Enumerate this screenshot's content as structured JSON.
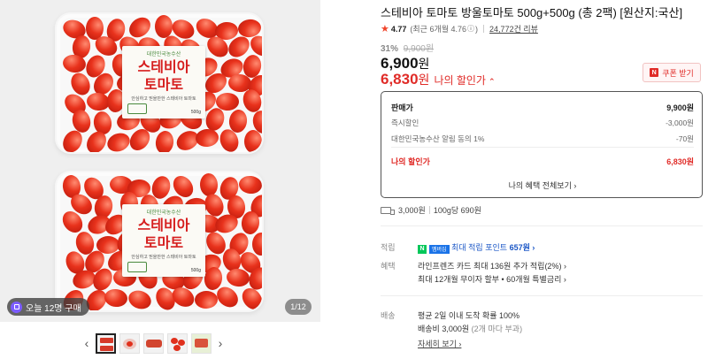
{
  "product": {
    "title": "스테비아 토마토 방울토마토 500g+500g (총 2팩) [원산지:국산]",
    "rating": "4.77",
    "recent_rating": "(최근 6개월 4.76",
    "recent_rating_close": ")",
    "review_count": "24,772건 리뷰"
  },
  "gallery": {
    "label_brand": "대한민국농수산",
    "label_line1": "스테비아",
    "label_line2": "토마토",
    "label_sub": "안심하고 믿을만한 스테비아 토마토",
    "label_weight": "500g",
    "buy_badge": "오늘 12명 구매",
    "page_indicator": "1/12",
    "prev_arrow": "‹",
    "next_arrow": "›"
  },
  "pricing": {
    "discount_pct": "31%",
    "original_price": "9,900원",
    "sale_price_num": "6,900",
    "sale_price_unit": "원",
    "my_price_num": "6,830",
    "my_price_unit": "원",
    "my_price_label": "나의 할인가",
    "coupon_button": "쿠폰 받기",
    "coupon_icon": "N"
  },
  "price_box": {
    "rows": [
      {
        "label": "판매가",
        "value": "9,900원"
      },
      {
        "label": "즉시할인",
        "value": "-3,000원"
      },
      {
        "label": "대한민국농수산 알림 동의 1%",
        "value": "-70원"
      },
      {
        "label": "나의 할인가",
        "value": "6,830원"
      }
    ],
    "benefits_link": "나의 혜택 전체보기 ›"
  },
  "shipping_summary": {
    "fee": "3,000원",
    "unit_price": "100g당 690원"
  },
  "details": {
    "points_label": "적립",
    "npay_logo": "N",
    "pay_logo": "멤버십",
    "points_text": "최대 적립 포인트",
    "points_value": "657원 ›",
    "benefit_label": "혜택",
    "benefit_line1": "라인프렌즈 카드 최대 136원 추가 적립(2%) ›",
    "benefit_line2": "최대 12개월 무이자 할부 • 60개월 특별금리 ›",
    "delivery_label": "배송",
    "delivery_line1": "평균 2일 이내 도착 확률 100%",
    "delivery_fee": "배송비 3,000원",
    "delivery_note": "(2개 마다 부과)",
    "more_link": "자세히 보기 ›"
  },
  "colors": {
    "accent_red": "#e02b27",
    "npay_green": "#03c75a",
    "point_blue": "#1a56c6"
  }
}
